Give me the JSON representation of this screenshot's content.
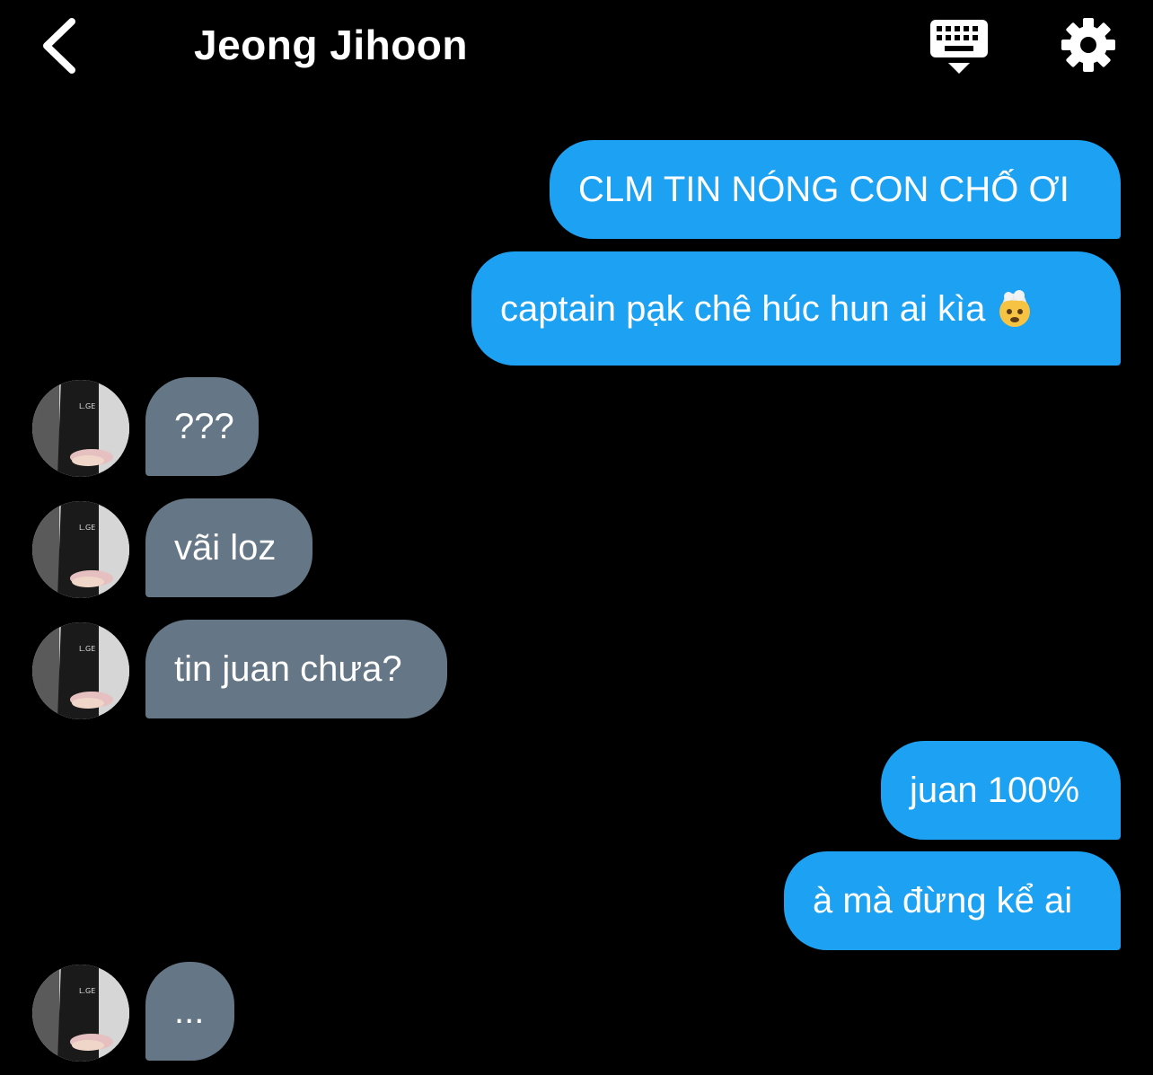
{
  "header": {
    "title": "Jeong Jihoon",
    "back_icon": "chevron-left-icon",
    "keyboard_icon": "keyboard-hide-icon",
    "settings_icon": "gear-icon"
  },
  "colors": {
    "background": "#000000",
    "outgoing_bubble": "#1da1f2",
    "incoming_bubble": "#657786",
    "text": "#ffffff"
  },
  "messages": [
    {
      "direction": "outgoing",
      "text": "CLM TIN NÓNG CON CHỐ ƠI"
    },
    {
      "direction": "outgoing",
      "text": "captain pạk chê húc hun ai kìa",
      "emoji": "exploding-head-emoji"
    },
    {
      "direction": "incoming",
      "text": "???"
    },
    {
      "direction": "incoming",
      "text": "vãi loz"
    },
    {
      "direction": "incoming",
      "text": "tin juan chưa?"
    },
    {
      "direction": "outgoing",
      "text": "juan 100%"
    },
    {
      "direction": "outgoing",
      "text": "à mà đừng kể ai"
    },
    {
      "direction": "incoming",
      "text": "..."
    }
  ]
}
